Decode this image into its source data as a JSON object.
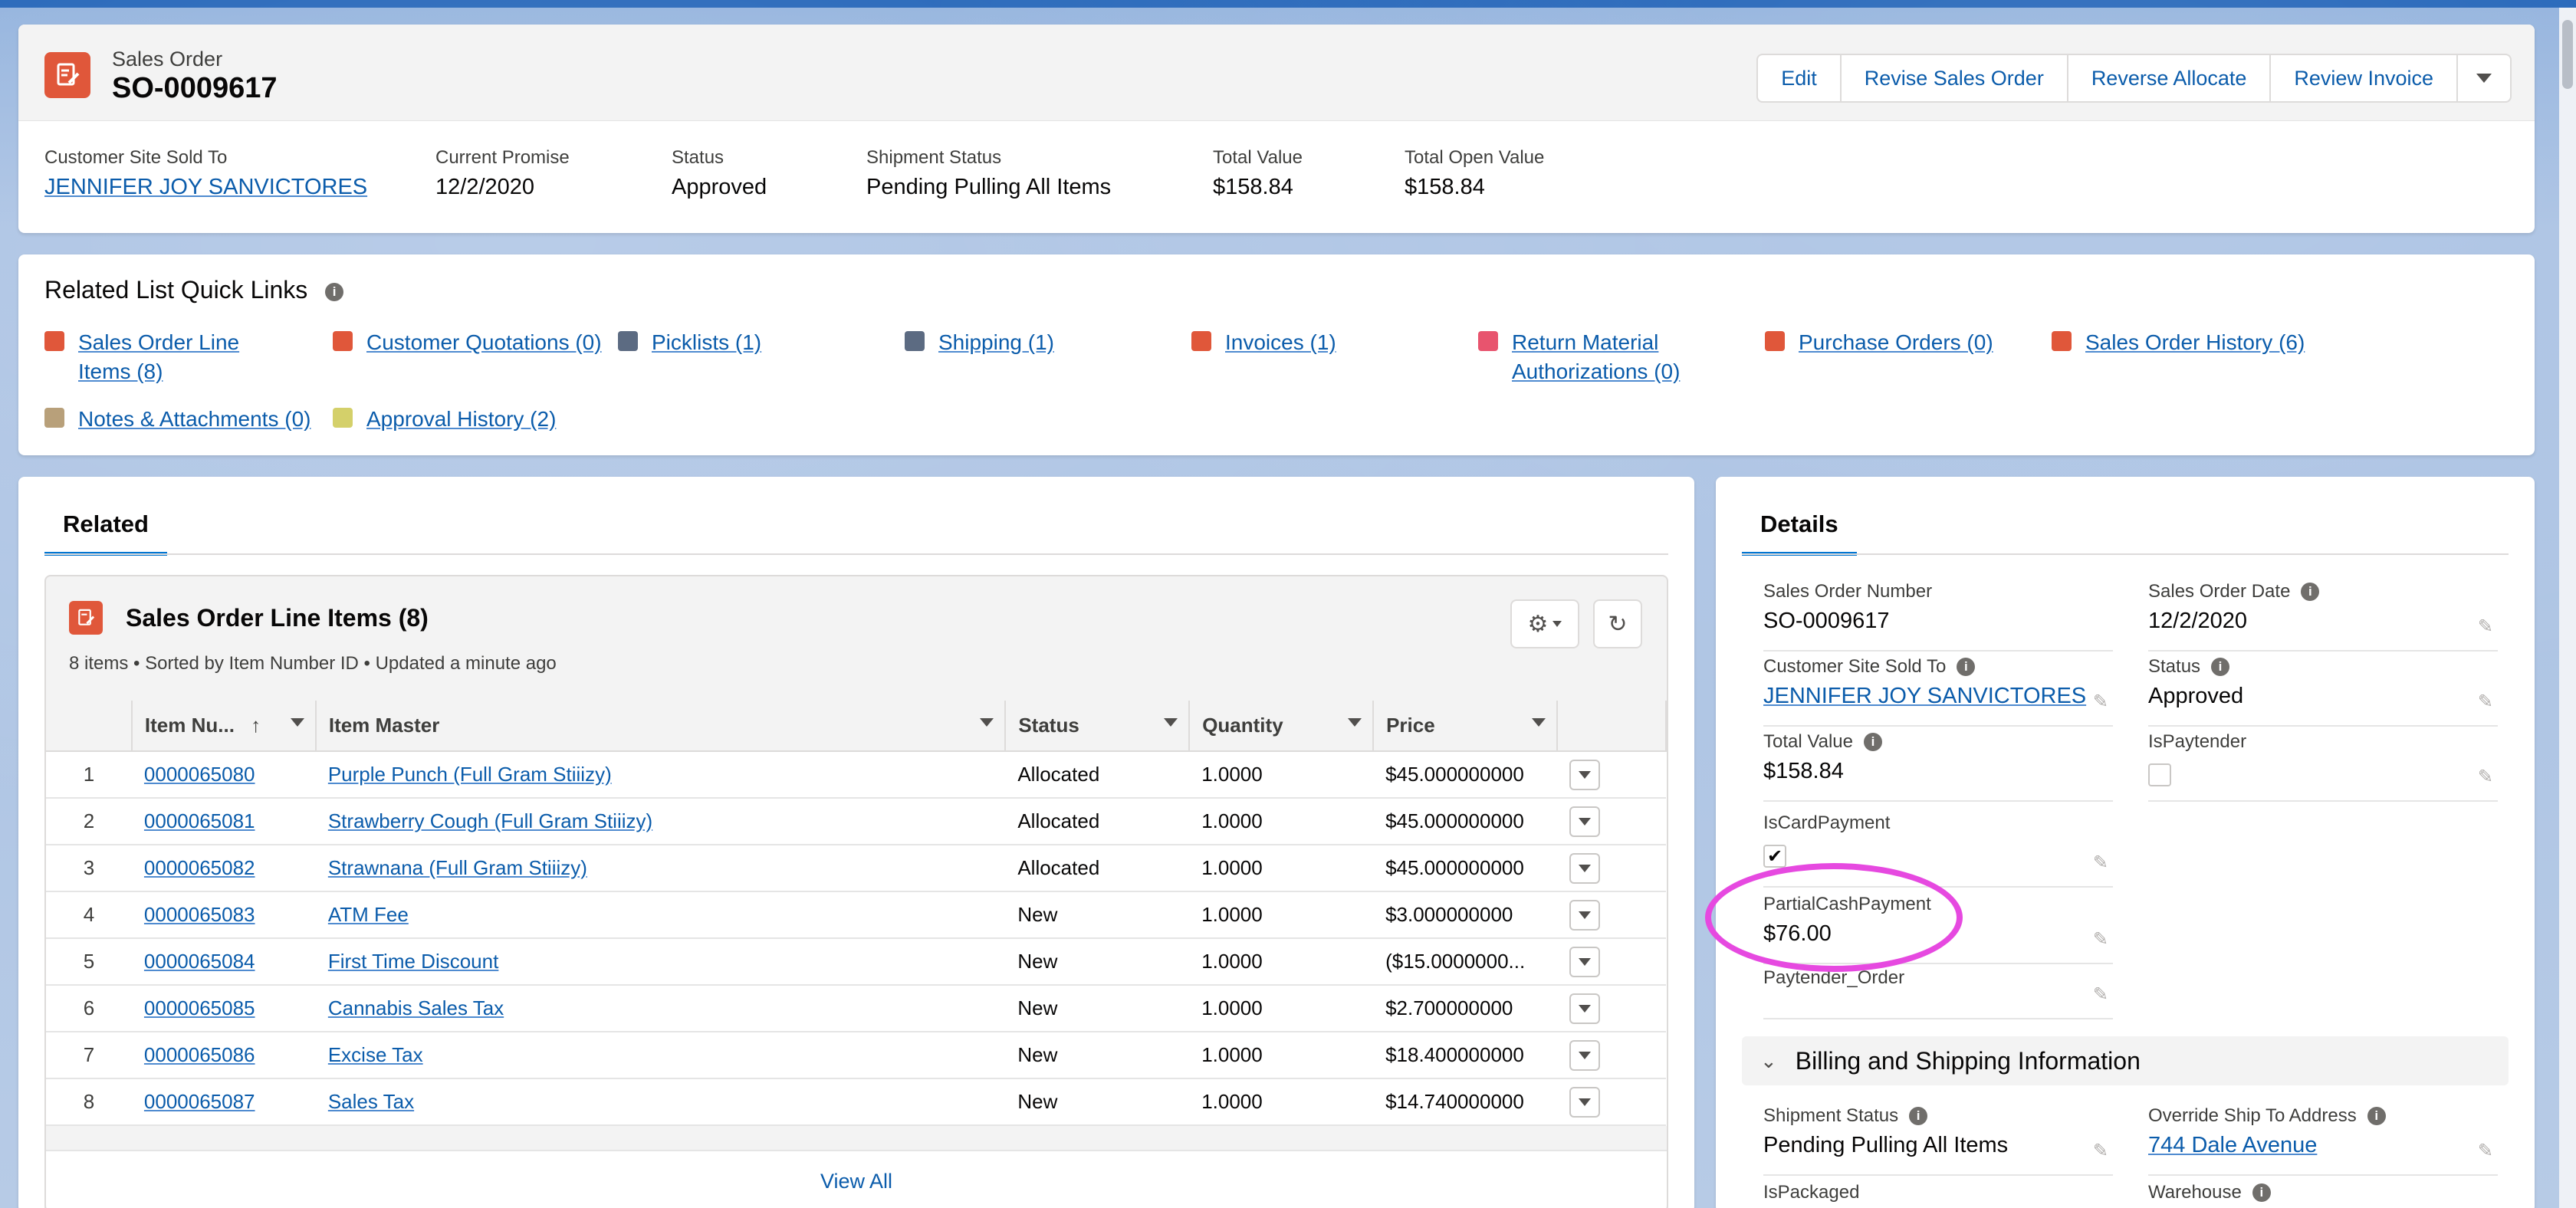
{
  "record": {
    "object_label": "Sales Order",
    "title": "SO-0009617",
    "actions": [
      "Edit",
      "Revise Sales Order",
      "Reverse Allocate",
      "Review Invoice"
    ],
    "highlights": [
      {
        "label": "Customer Site Sold To",
        "value": "JENNIFER JOY SANVICTORES",
        "link": true
      },
      {
        "label": "Current Promise",
        "value": "12/2/2020",
        "link": false
      },
      {
        "label": "Status",
        "value": "Approved",
        "link": false
      },
      {
        "label": "Shipment Status",
        "value": "Pending Pulling All Items",
        "link": false
      },
      {
        "label": "Total Value",
        "value": "$158.84",
        "link": false
      },
      {
        "label": "Total Open Value",
        "value": "$158.84",
        "link": false
      }
    ]
  },
  "quick_links": {
    "title": "Related List Quick Links",
    "items": [
      {
        "line1": "Sales Order Line",
        "line2": "Items (8)",
        "color": "#e0573a"
      },
      {
        "line1": "Customer Quotations (0)",
        "line2": "",
        "color": "#e0573a"
      },
      {
        "line1": "Picklists (1)",
        "line2": "",
        "color": "#5c6b82"
      },
      {
        "line1": "Shipping (1)",
        "line2": "",
        "color": "#5c6b82"
      },
      {
        "line1": "Invoices (1)",
        "line2": "",
        "color": "#e0573a"
      },
      {
        "line1": "Return Material",
        "line2": "Authorizations (0)",
        "color": "#e8546e"
      },
      {
        "line1": "Purchase Orders (0)",
        "line2": "",
        "color": "#e0573a"
      },
      {
        "line1": "Sales Order History (6)",
        "line2": "",
        "color": "#e0573a"
      },
      {
        "line1": "Notes & Attachments (0)",
        "line2": "",
        "color": "#b8a07a"
      },
      {
        "line1": "Approval History (2)",
        "line2": "",
        "color": "#d4d06a"
      }
    ]
  },
  "related": {
    "tab": "Related",
    "list_title": "Sales Order Line Items (8)",
    "list_subtitle": "8 items • Sorted by Item Number ID • Updated a minute ago",
    "columns": [
      "Item Nu...",
      "Item Master",
      "Status",
      "Quantity",
      "Price"
    ],
    "rows": [
      {
        "n": "1",
        "item": "0000065080",
        "master": "Purple Punch (Full Gram Stiiizy)",
        "status": "Allocated",
        "qty": "1.0000",
        "price": "$45.000000000"
      },
      {
        "n": "2",
        "item": "0000065081",
        "master": "Strawberry Cough (Full Gram Stiiizy)",
        "status": "Allocated",
        "qty": "1.0000",
        "price": "$45.000000000"
      },
      {
        "n": "3",
        "item": "0000065082",
        "master": "Strawnana (Full Gram Stiiizy)",
        "status": "Allocated",
        "qty": "1.0000",
        "price": "$45.000000000"
      },
      {
        "n": "4",
        "item": "0000065083",
        "master": "ATM Fee",
        "status": "New",
        "qty": "1.0000",
        "price": "$3.000000000"
      },
      {
        "n": "5",
        "item": "0000065084",
        "master": "First Time Discount",
        "status": "New",
        "qty": "1.0000",
        "price": "($15.0000000..."
      },
      {
        "n": "6",
        "item": "0000065085",
        "master": "Cannabis Sales Tax",
        "status": "New",
        "qty": "1.0000",
        "price": "$2.700000000"
      },
      {
        "n": "7",
        "item": "0000065086",
        "master": "Excise Tax",
        "status": "New",
        "qty": "1.0000",
        "price": "$18.400000000"
      },
      {
        "n": "8",
        "item": "0000065087",
        "master": "Sales Tax",
        "status": "New",
        "qty": "1.0000",
        "price": "$14.740000000"
      }
    ],
    "view_all": "View All"
  },
  "details": {
    "tab": "Details",
    "sales_order_number": {
      "label": "Sales Order Number",
      "value": "SO-0009617"
    },
    "sales_order_date": {
      "label": "Sales Order Date",
      "value": "12/2/2020"
    },
    "customer_site": {
      "label": "Customer Site Sold To",
      "value": "JENNIFER JOY SANVICTORES"
    },
    "status": {
      "label": "Status",
      "value": "Approved"
    },
    "total_value": {
      "label": "Total Value",
      "value": "$158.84"
    },
    "is_paytender": {
      "label": "IsPaytender",
      "checked": false
    },
    "is_card_payment": {
      "label": "IsCardPayment",
      "checked": true,
      "check_glyph": "✔"
    },
    "partial_cash": {
      "label": "PartialCashPayment",
      "value": "$76.00"
    },
    "overlapped_label": "Paytender_Order",
    "billing_section": "Billing and Shipping Information",
    "shipment_status": {
      "label": "Shipment Status",
      "value": "Pending Pulling All Items"
    },
    "override_ship": {
      "label": "Override Ship To Address",
      "value": "744 Dale Avenue"
    },
    "is_packaged": {
      "label": "IsPackaged"
    },
    "warehouse": {
      "label": "Warehouse"
    }
  },
  "colors": {
    "accent": "#0176d3",
    "link": "#0b5cab",
    "annotation": "#e649e0",
    "object_icon": "#e0573a"
  }
}
